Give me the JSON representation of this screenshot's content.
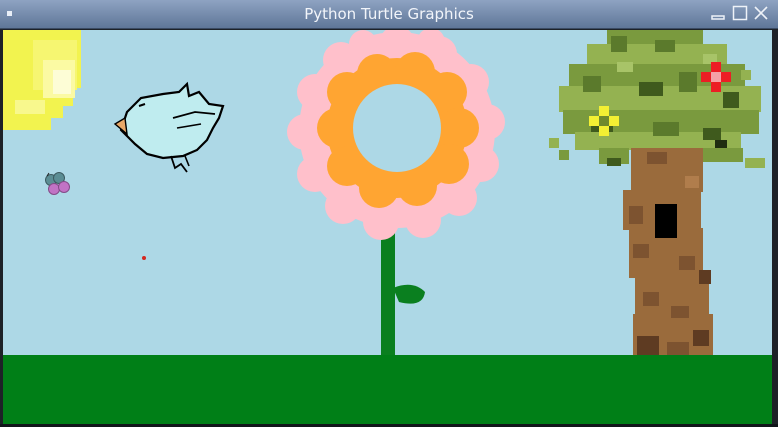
{
  "window": {
    "title": "Python Turtle Graphics",
    "controls": [
      "minimize",
      "maximize",
      "close"
    ]
  },
  "scene": {
    "background_color": "#add8e6",
    "grass_color": "#007f17",
    "sun_colors": [
      "#f2f34f",
      "#fbfaa3"
    ],
    "bird_color": "#bfecef",
    "butterfly_colors": [
      "#5b8d94",
      "#c173c5"
    ],
    "flower_petal_color": "#ffc0cb",
    "flower_center_color": "#ffa532",
    "stem_color": "#0a7f1f",
    "tree_leaf_colors": [
      "#5b7a2c",
      "#7a9a3e",
      "#94b251",
      "#3f5a1d"
    ],
    "trunk_colors": [
      "#9a6b3c",
      "#7d5330",
      "#5e3b22"
    ],
    "trunk_hole_color": "#000000",
    "tree_flower_colors": [
      "#ec1e24",
      "#f3f033"
    ],
    "icons": [
      "window-menu-icon",
      "minimize-icon",
      "maximize-icon",
      "close-icon"
    ]
  }
}
